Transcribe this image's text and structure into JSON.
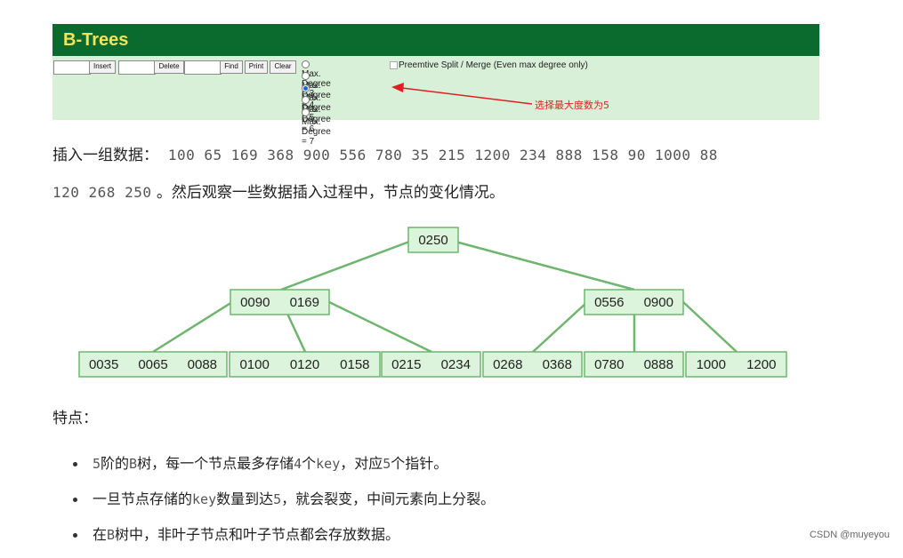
{
  "visualizer": {
    "title": "B-Trees",
    "buttons": {
      "insert": "Insert",
      "delete": "Delete",
      "find": "Find",
      "print": "Print",
      "clear": "Clear"
    },
    "degree_options": [
      "Max. Degree = 3",
      "Max. Degree = 4",
      "Max. Degree = 5",
      "Max. Degree = 6",
      "Max. Degree = 7"
    ],
    "selected_degree": "Max. Degree = 5",
    "preemptive_label": "Preemtive Split / Merge (Even max degree only)",
    "annotation": "选择最大度数为5",
    "accent_header": "#0b6b2e",
    "accent_title": "#f3e35a",
    "panel_bg": "#d8efd8",
    "annotation_color": "#e02020"
  },
  "article": {
    "insert_prefix": "插入一组数据：",
    "insert_values_line1": "100 65 169 368 900 556 780 35 215 1200 234 888 158 90 1000 88",
    "insert_values_line2": "120 268 250",
    "insert_suffix": "。然后观察一些数据插入过程中，节点的变化情况。",
    "features_heading": "特点：",
    "bullets": [
      [
        "5",
        "阶的",
        "B",
        "树，每一个节点最多存储",
        "4",
        "个",
        "key",
        "，对应",
        "5",
        "个指针。"
      ],
      [
        "一旦节点存储的",
        "key",
        "数量到达",
        "5",
        "，就会裂变，中间元素向上分裂。"
      ],
      [
        "在",
        "B",
        "树中，非叶子节点和叶子节点都会存放数据。"
      ]
    ]
  },
  "tree": {
    "root": [
      "0250"
    ],
    "level1": [
      [
        "0090",
        "0169"
      ],
      [
        "0556",
        "0900"
      ]
    ],
    "leaves": [
      [
        "0035",
        "0065",
        "0088"
      ],
      [
        "0100",
        "0120",
        "0158"
      ],
      [
        "0215",
        "0234"
      ],
      [
        "0268",
        "0368"
      ],
      [
        "0780",
        "0888"
      ],
      [
        "1000",
        "1200"
      ]
    ],
    "node_fill": "#ddf4dc",
    "edge_color": "#6fb56f"
  },
  "watermark": "CSDN @muyeyou"
}
